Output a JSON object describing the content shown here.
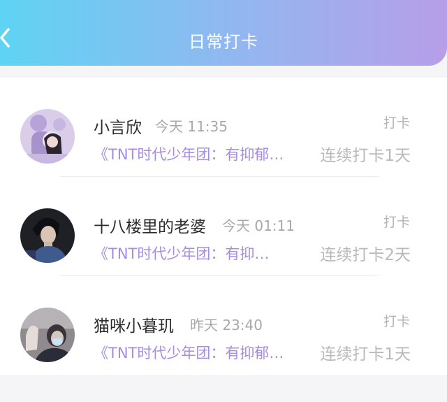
{
  "header": {
    "title": "日常打卡",
    "back_icon": "chevron-left-icon",
    "gradient": [
      "#5fd3f3",
      "#94b6f0",
      "#b79ee9"
    ]
  },
  "accent_color": "#a88ce4",
  "entries": [
    {
      "name": "小言欣",
      "time": "今天 11:35",
      "action": "打卡",
      "group": "《TNT时代少年团：有抑郁…",
      "streak": "连续打卡1天"
    },
    {
      "name": "十八楼里的老婆",
      "time": "今天 01:11",
      "action": "打卡",
      "group": "《TNT时代少年团：有抑…",
      "streak": "连续打卡2天"
    },
    {
      "name": "猫咪小暮玑",
      "time": "昨天 23:40",
      "action": "打卡",
      "group": "《TNT时代少年团：有抑郁…",
      "streak": "连续打卡1天"
    }
  ]
}
